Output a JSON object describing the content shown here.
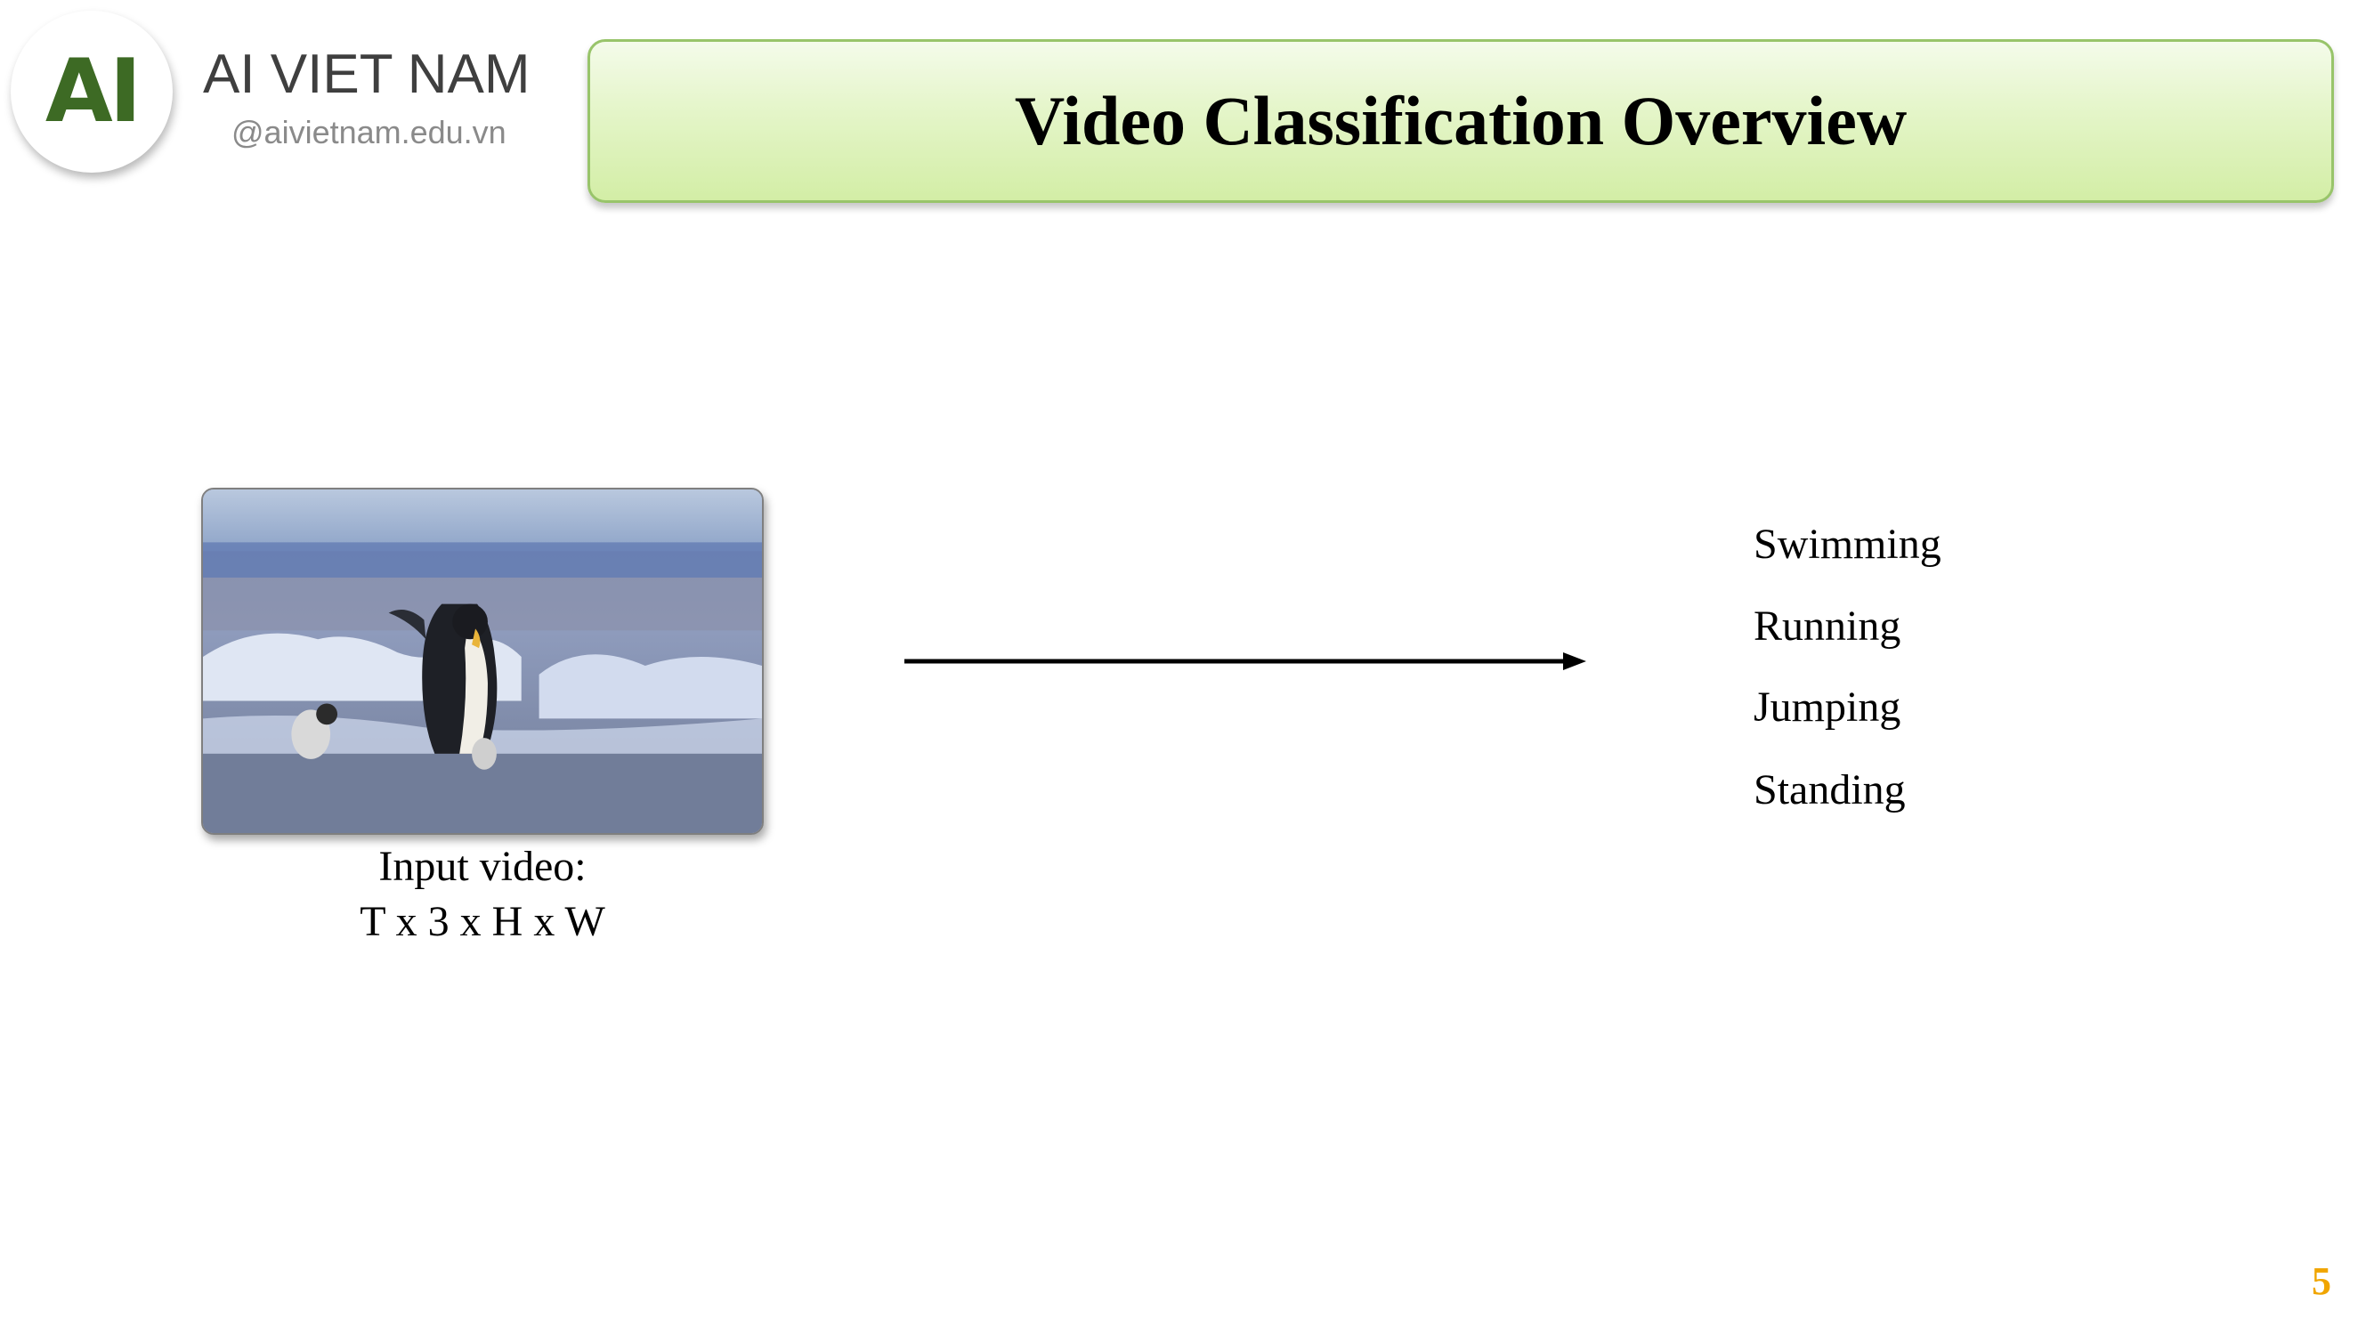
{
  "brand": {
    "logo_mark": "AI",
    "name": "AI VIET NAM",
    "url": "@aivietnam.edu.vn",
    "accent_color": "#3d6a24"
  },
  "slide": {
    "title": "Video Classification Overview",
    "page_number": "5",
    "page_number_color": "#f0a500"
  },
  "input": {
    "caption_line1": "Input video:",
    "caption_line2": "T x 3 x H x W",
    "image_subject": "penguin-adult-and-chick-on-ice"
  },
  "classes": [
    {
      "label": "Swimming"
    },
    {
      "label": "Running"
    },
    {
      "label": "Jumping"
    },
    {
      "label": "Standing"
    }
  ],
  "icons": {
    "arrow": "right-arrow-icon"
  }
}
